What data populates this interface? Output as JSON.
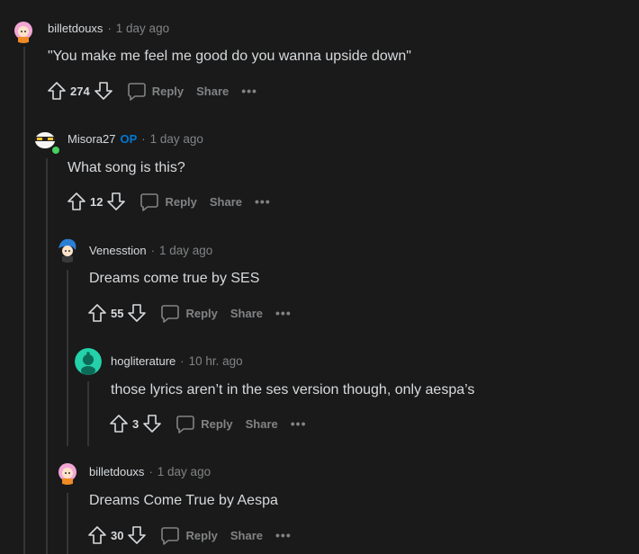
{
  "comments": [
    {
      "user": "billetdouxs",
      "op": "",
      "time": "1 day ago",
      "text": "\"You make me feel me good do you wanna upside down\"",
      "score": "274",
      "reply": "Reply",
      "share": "Share",
      "more": "•••"
    },
    {
      "user": "Misora27",
      "op": "OP",
      "time": "1 day ago",
      "text": "What song is this?",
      "score": "12",
      "reply": "Reply",
      "share": "Share",
      "more": "•••"
    },
    {
      "user": "Venesstion",
      "op": "",
      "time": "1 day ago",
      "text": "Dreams come true by SES",
      "score": "55",
      "reply": "Reply",
      "share": "Share",
      "more": "•••"
    },
    {
      "user": "hogliterature",
      "op": "",
      "time": "10 hr. ago",
      "text": "those lyrics aren’t in the ses version though, only aespa’s",
      "score": "3",
      "reply": "Reply",
      "share": "Share",
      "more": "•••"
    },
    {
      "user": "billetdouxs",
      "op": "",
      "time": "1 day ago",
      "text": "Dreams Come True by Aespa",
      "score": "30",
      "reply": "Reply",
      "share": "Share",
      "more": "•••"
    }
  ],
  "separator": "·",
  "colors": {
    "background": "#1a1a1b",
    "op": "#0079d3",
    "muted": "#818384",
    "text": "#d7dadc",
    "online": "#46d160"
  }
}
